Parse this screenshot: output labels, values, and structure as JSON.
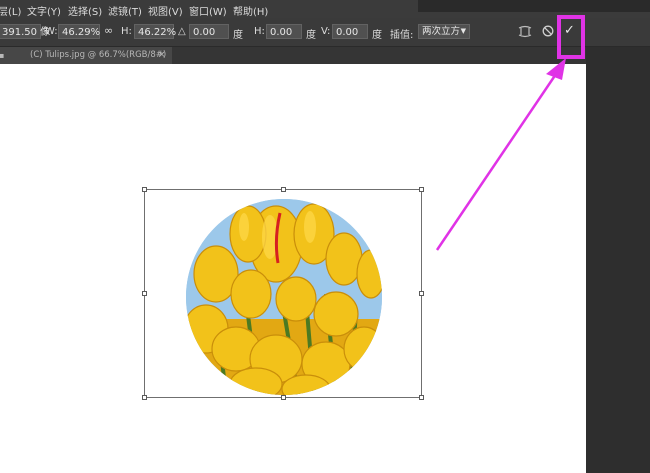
{
  "menu": [
    "层(L)",
    "文字(Y)",
    "选择(S)",
    "滤镜(T)",
    "视图(V)",
    "窗口(W)",
    "帮助(H)"
  ],
  "options": {
    "x_value": "391.50 像",
    "w_label": "W:",
    "w_value": "46.29%",
    "link_glyph": "∞",
    "h_label": "H:",
    "h_value": "46.22%",
    "angle_glyph": "△",
    "angle_value": "0.00",
    "angle_unit": "度",
    "hskew_label": "H:",
    "hskew_value": "0.00",
    "hskew_unit": "度",
    "vskew_label": "V:",
    "vskew_value": "0.00",
    "vskew_unit": "度",
    "interp_label": "插值:",
    "interp_value": "两次立方",
    "warp_icon": "warp-mode-icon",
    "cancel_icon": "cancel-transform-icon",
    "commit_glyph": "✓"
  },
  "document": {
    "tab_label": "(C) Tulips.jpg @ 66.7%(RGB/8#)",
    "tab_close": "×"
  },
  "colors": {
    "highlight": "#e033e6",
    "canvas": "#ffffff",
    "tulip": "#f2c21a",
    "sky": "#9cc8ea"
  }
}
